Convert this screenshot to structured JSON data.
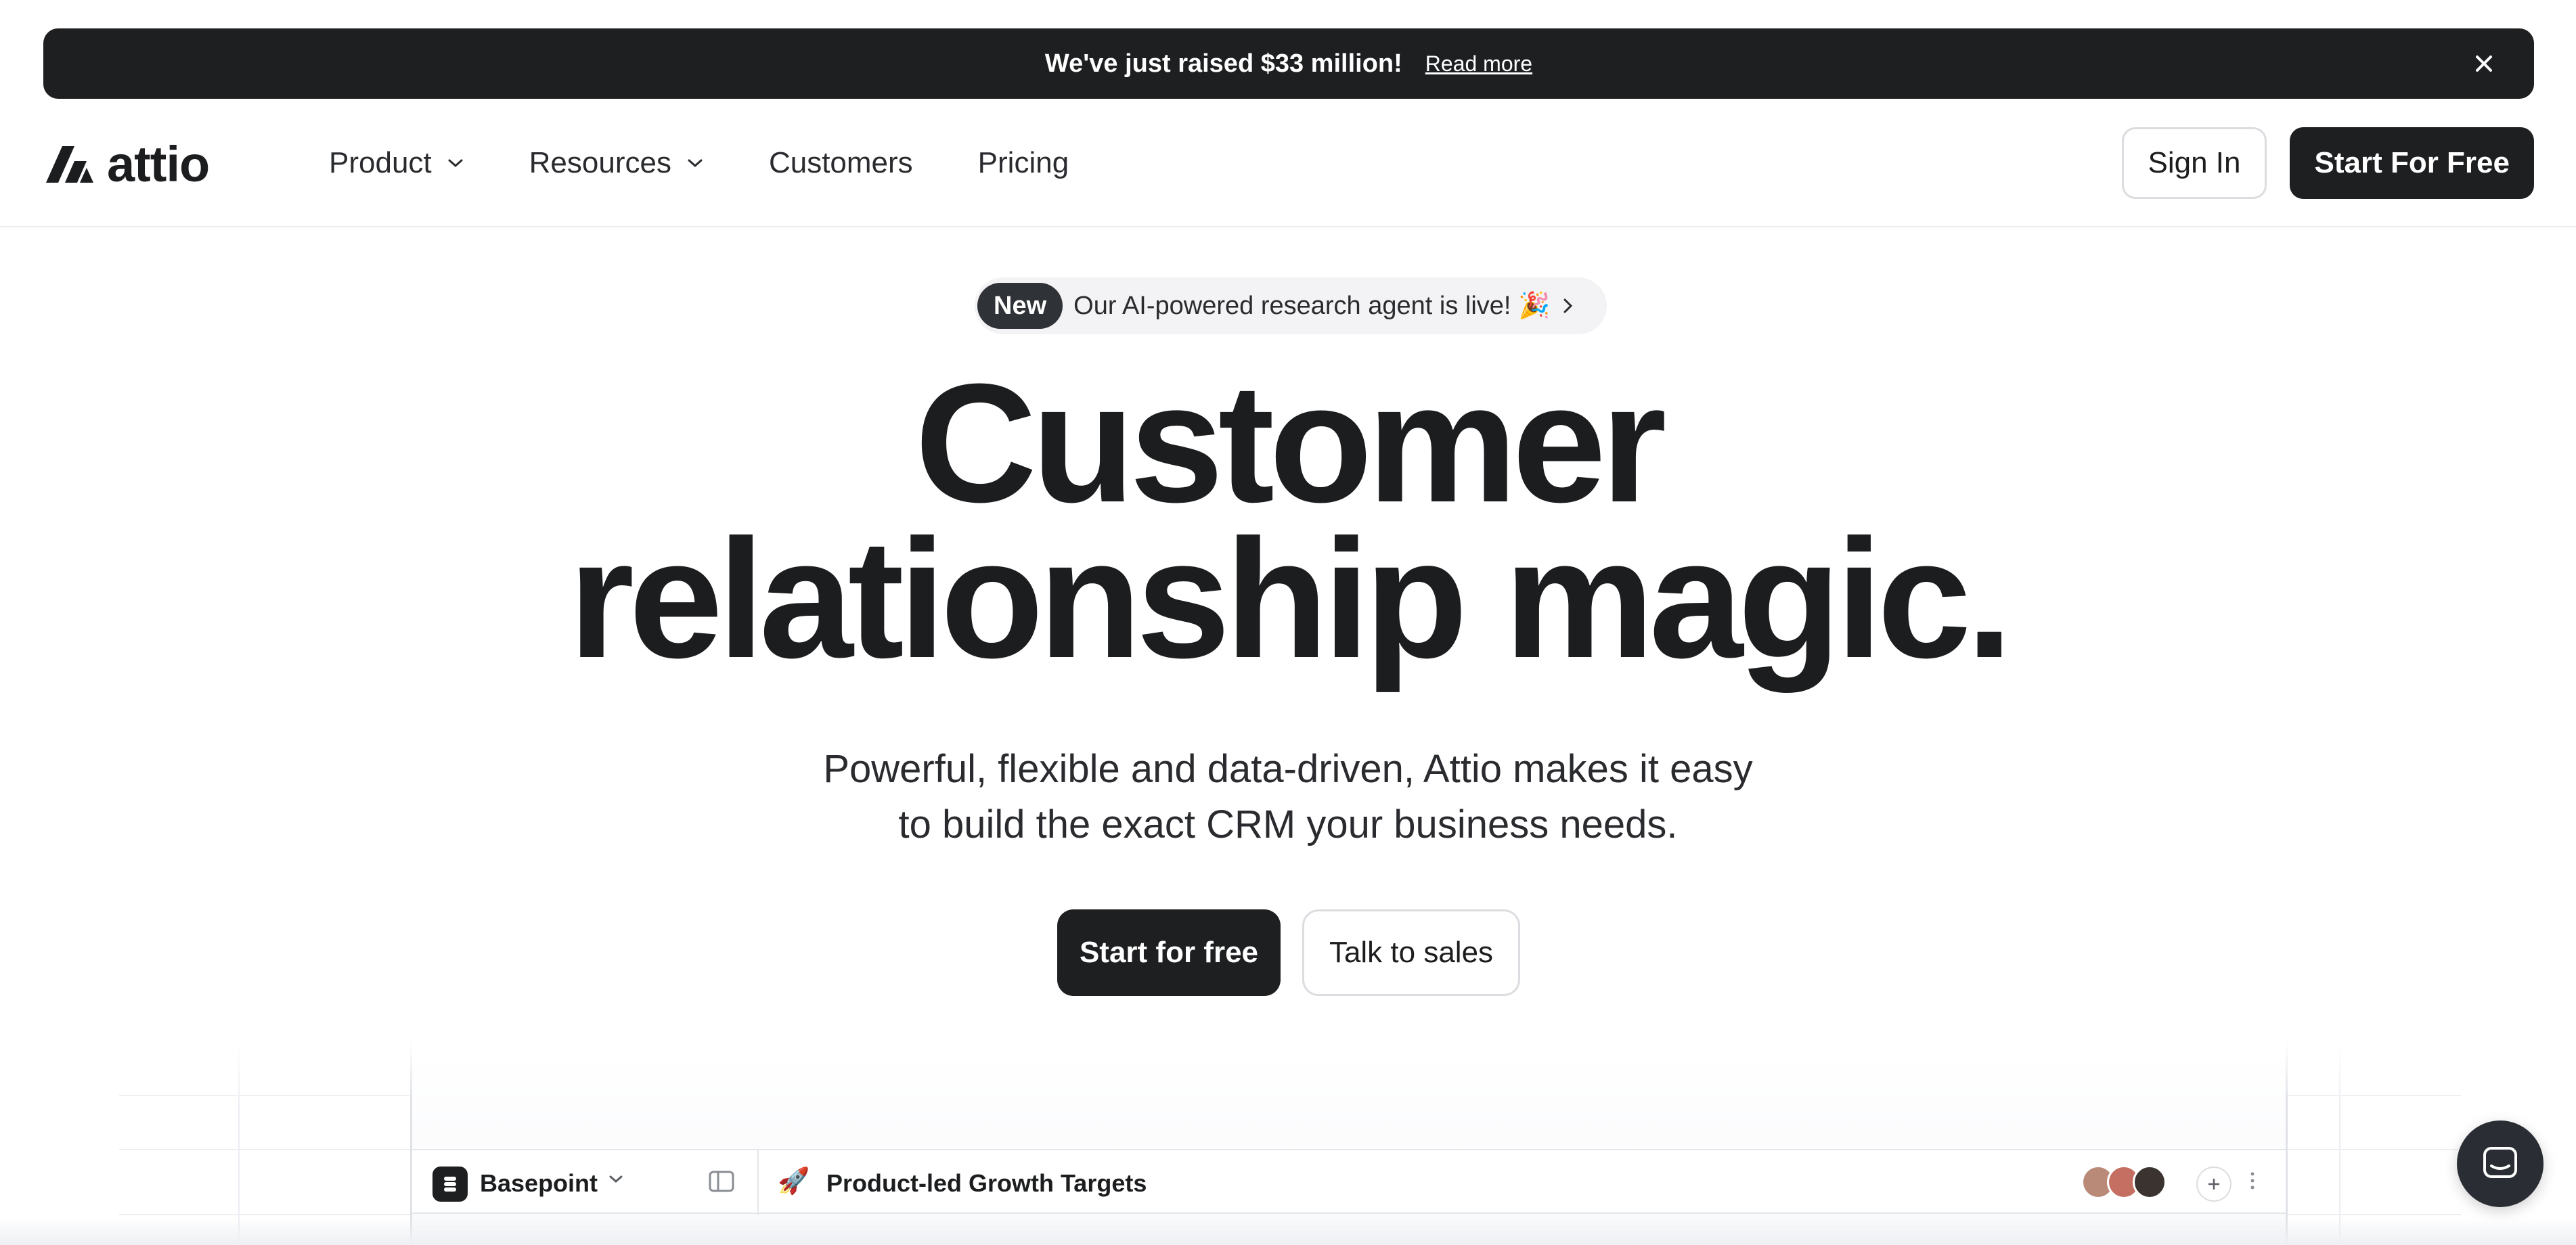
{
  "announcement": {
    "text": "We've just raised $33 million!",
    "link": "Read more"
  },
  "header": {
    "logo_text": "attio",
    "nav": [
      {
        "label": "Product",
        "has_dropdown": true
      },
      {
        "label": "Resources",
        "has_dropdown": true
      },
      {
        "label": "Customers",
        "has_dropdown": false
      },
      {
        "label": "Pricing",
        "has_dropdown": false
      }
    ],
    "sign_in": "Sign In",
    "start_free": "Start For Free"
  },
  "hero": {
    "badge_label": "New",
    "badge_text": "Our AI-powered research agent is live! 🎉",
    "headline_line1": "Customer",
    "headline_line2": "relationship magic.",
    "subheadline_line1": "Powerful, flexible and data-driven, Attio makes it easy",
    "subheadline_line2": "to build the exact CRM your business needs.",
    "cta_primary": "Start for free",
    "cta_secondary": "Talk to sales"
  },
  "app_preview": {
    "workspace_name": "Basepoint",
    "list_emoji": "🚀",
    "list_title": "Product-led Growth Targets",
    "avatar_colors": [
      "#b98a78",
      "#c46f62",
      "#3a3330"
    ]
  },
  "icons": {
    "close": "close-icon",
    "chevron": "chevron-down-icon",
    "chat": "chat-icon"
  }
}
